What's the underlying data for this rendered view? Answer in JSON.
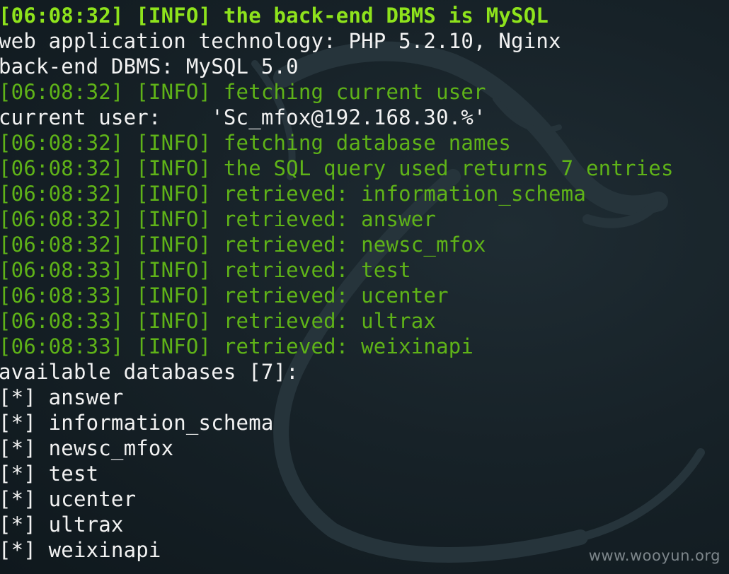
{
  "terminal": {
    "lines": [
      {
        "text": "[06:08:32] [INFO] the back-end DBMS is MySQL",
        "color": "#8ee31c",
        "bold": true
      },
      {
        "text": "web application technology: PHP 5.2.10, Nginx",
        "color": "#f2f2f2"
      },
      {
        "text": "back-end DBMS: MySQL 5.0",
        "color": "#f2f2f2"
      },
      {
        "text": "[06:08:32] [INFO] fetching current user",
        "color": "#5fb318"
      },
      {
        "text": "current user:    'Sc_mfox@192.168.30.%'",
        "color": "#f2f2f2"
      },
      {
        "text": "[06:08:32] [INFO] fetching database names",
        "color": "#5fb318"
      },
      {
        "text": "[06:08:32] [INFO] the SQL query used returns 7 entries",
        "color": "#5fb318"
      },
      {
        "text": "[06:08:32] [INFO] retrieved: information_schema",
        "color": "#5fb318"
      },
      {
        "text": "[06:08:32] [INFO] retrieved: answer",
        "color": "#5fb318"
      },
      {
        "text": "[06:08:32] [INFO] retrieved: newsc_mfox",
        "color": "#5fb318"
      },
      {
        "text": "[06:08:33] [INFO] retrieved: test",
        "color": "#5fb318"
      },
      {
        "text": "[06:08:33] [INFO] retrieved: ucenter",
        "color": "#5fb318"
      },
      {
        "text": "[06:08:33] [INFO] retrieved: ultrax",
        "color": "#5fb318"
      },
      {
        "text": "[06:08:33] [INFO] retrieved: weixinapi",
        "color": "#5fb318"
      },
      {
        "text": "available databases [7]:",
        "color": "#f2f2f2"
      },
      {
        "text": "[*] answer",
        "color": "#f2f2f2"
      },
      {
        "text": "[*] information_schema",
        "color": "#f2f2f2"
      },
      {
        "text": "[*] newsc_mfox",
        "color": "#f2f2f2"
      },
      {
        "text": "[*] test",
        "color": "#f2f2f2"
      },
      {
        "text": "[*] ucenter",
        "color": "#f2f2f2"
      },
      {
        "text": "[*] ultrax",
        "color": "#f2f2f2"
      },
      {
        "text": "[*] weixinapi",
        "color": "#f2f2f2"
      }
    ]
  },
  "watermark": {
    "text": "www.wooyun.org"
  },
  "background": {
    "icon": "kali-dragon-icon"
  }
}
